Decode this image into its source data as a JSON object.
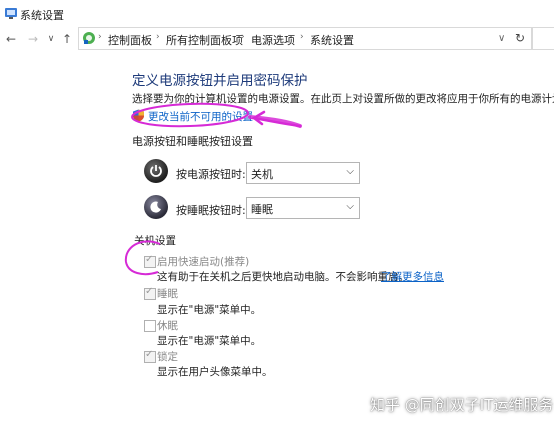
{
  "window": {
    "title": "系统设置"
  },
  "nav": {
    "back": "←",
    "forward": "→",
    "recent": "∨",
    "up": "↑",
    "refresh": "↻"
  },
  "breadcrumbs": [
    "控制面板",
    "所有控制面板项",
    "电源选项",
    "系统设置"
  ],
  "main": {
    "heading": "定义电源按钮并启用密码保护",
    "description": "选择要为你的计算机设置的电源设置。在此页上对设置所做的更改将应用于你所有的电源计划。",
    "change_link": "更改当前不可用的设置",
    "section_title": "电源按钮和睡眠按钮设置",
    "power_button": {
      "label": "按电源按钮时:",
      "value": "关机"
    },
    "sleep_button": {
      "label": "按睡眠按钮时:",
      "value": "睡眠"
    },
    "shutdown": {
      "title": "关机设置",
      "fast_startup": {
        "label": "启用快速启动(推荐)",
        "checked": true,
        "description": "这有助于在关机之后更快地启动电脑。不会影响重启。",
        "link": "了解更多信息"
      },
      "sleep": {
        "label": "睡眠",
        "checked": true,
        "description": "显示在\"电源\"菜单中。"
      },
      "hibernate": {
        "label": "休眠",
        "checked": false,
        "description": "显示在\"电源\"菜单中。"
      },
      "lock": {
        "label": "锁定",
        "checked": true,
        "description": "显示在用户头像菜单中。"
      }
    }
  },
  "watermark": "知乎 @同创双子IT运维服务",
  "colors": {
    "heading": "#1d3a7a",
    "link": "#0b62c7",
    "annotation": "#d62ad6"
  }
}
